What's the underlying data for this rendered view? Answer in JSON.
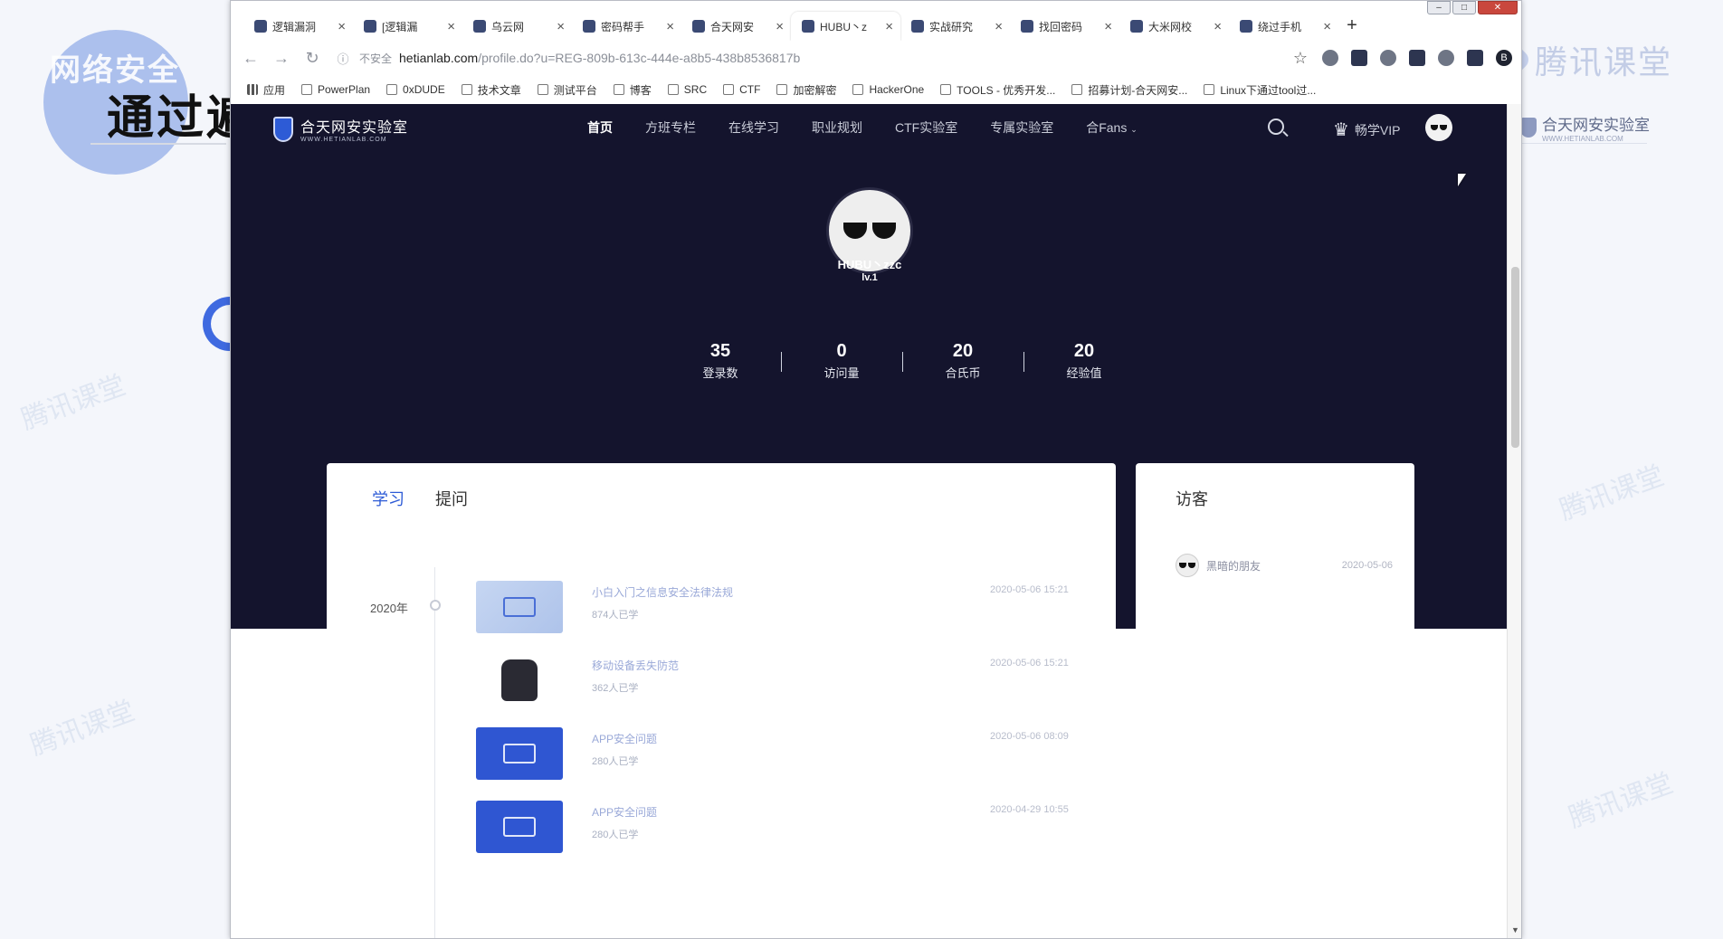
{
  "slide": {
    "subtitle": "网络安全",
    "title": "通过遍",
    "watermark": "腾讯课堂",
    "brand": "腾讯课堂",
    "right_logo_name": "合天网安实验室",
    "right_logo_url": "WWW.HETIANLAB.COM"
  },
  "browser": {
    "tabs": [
      {
        "title": "逻辑漏洞"
      },
      {
        "title": "[逻辑漏"
      },
      {
        "title": "乌云网"
      },
      {
        "title": "密码帮手"
      },
      {
        "title": "合天网安"
      },
      {
        "title": "HUBU丶z"
      },
      {
        "title": "实战研究"
      },
      {
        "title": "找回密码"
      },
      {
        "title": "大米网校"
      },
      {
        "title": "绕过手机"
      }
    ],
    "active_tab": 5,
    "new_tab": "+",
    "address": {
      "security": "不安全",
      "host": "hetianlab.com",
      "path": "/profile.do?u=REG-809b-613c-444e-a8b5-438b8536817b"
    },
    "profile_initial": "B",
    "bookmarks": [
      "应用",
      "PowerPlan",
      "0xDUDE",
      "技术文章",
      "测试平台",
      "博客",
      "SRC",
      "CTF",
      "加密解密",
      "HackerOne",
      "TOOLS - 优秀开发...",
      "招募计划-合天网安...",
      "Linux下通过tool过..."
    ]
  },
  "site": {
    "brand_name": "合天网安实验室",
    "brand_url": "WWW.HETIANLAB.COM",
    "menu": [
      "首页",
      "方班专栏",
      "在线学习",
      "职业规划",
      "CTF实验室",
      "专属实验室",
      "合Fans"
    ],
    "menu_active": 0,
    "vip_label": "畅学VIP"
  },
  "profile": {
    "username": "HUBU丶zzc",
    "level": "lv.1",
    "stats": [
      {
        "value": "35",
        "label": "登录数"
      },
      {
        "value": "0",
        "label": "访问量"
      },
      {
        "value": "20",
        "label": "合氏币"
      },
      {
        "value": "20",
        "label": "经验值"
      }
    ]
  },
  "main_card": {
    "tab_study": "学习",
    "tab_questions": "提问",
    "year": "2020年",
    "courses": [
      {
        "title": "小白入门之信息安全法律法规",
        "learners": "874人已学",
        "date": "2020-05-06 15:21",
        "thumb": "light"
      },
      {
        "title": "移动设备丢失防范",
        "learners": "362人已学",
        "date": "2020-05-06 15:21",
        "thumb": "robot"
      },
      {
        "title": "APP安全问题",
        "learners": "280人已学",
        "date": "2020-05-06 08:09",
        "thumb": "blue"
      },
      {
        "title": "APP安全问题",
        "learners": "280人已学",
        "date": "2020-04-29 10:55",
        "thumb": "blue"
      }
    ]
  },
  "side_card": {
    "title": "访客",
    "visitors": [
      {
        "name": "黑暗的朋友",
        "date": "2020-05-06"
      }
    ]
  },
  "colors": {
    "hero_bg": "#14142d",
    "accent": "#2d5bd6"
  }
}
